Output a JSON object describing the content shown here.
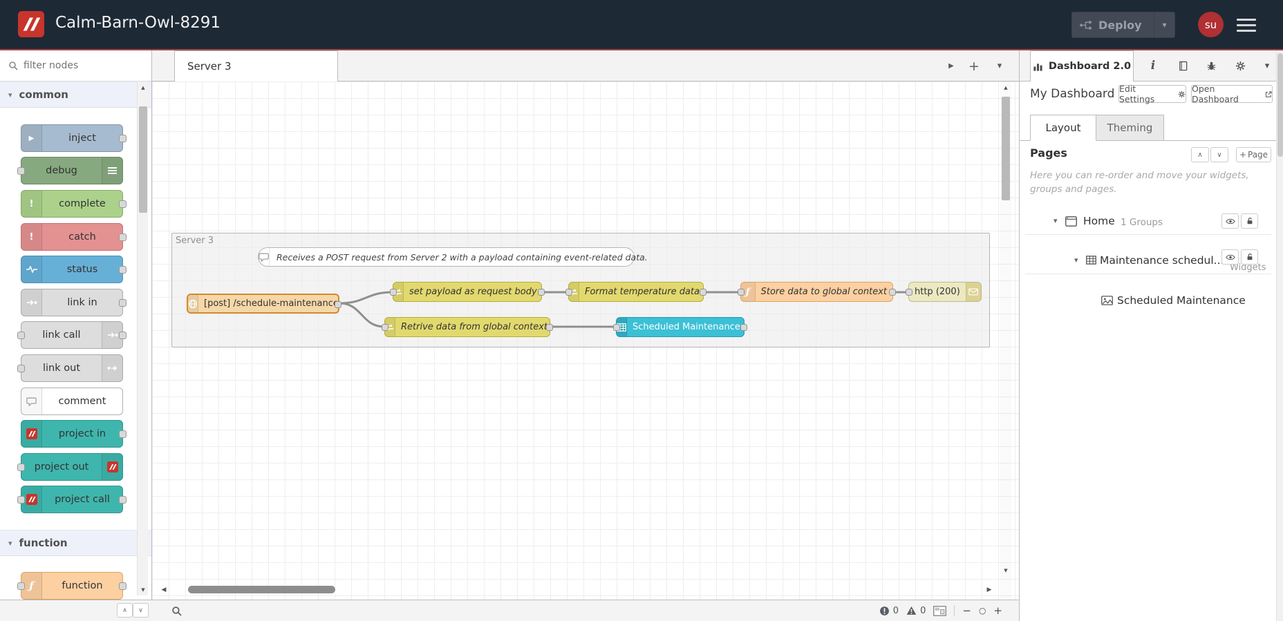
{
  "colors": {
    "header_bg": "#1e2936",
    "header_underline": "#aa4444",
    "brand_red": "#c7352c",
    "deploy_bg": "#434a56",
    "node_inject": "#a6bbcf",
    "node_debug": "#87a980",
    "node_complete": "#abd18b",
    "node_catch": "#e49191",
    "node_status": "#66b0d8",
    "node_link": "#dddddd",
    "node_project": "#3eb6ad",
    "node_function": "#fdd0a2",
    "node_change": "#e2d96e",
    "node_http_in": "#f6d7a8",
    "node_http_response": "#ece9c2",
    "node_ui_table": "#3bc0d6",
    "wire": "#8f8f8f"
  },
  "header": {
    "title": "Calm-Barn-Owl-8291",
    "deploy_label": "Deploy",
    "user_initials": "su"
  },
  "palette": {
    "filter_placeholder": "filter nodes",
    "categories": [
      {
        "label": "common",
        "nodes": [
          {
            "label": "inject",
            "icon": "▶"
          },
          {
            "label": "debug"
          },
          {
            "label": "complete",
            "icon": "!"
          },
          {
            "label": "catch",
            "icon": "!"
          },
          {
            "label": "status"
          },
          {
            "label": "link in"
          },
          {
            "label": "link call"
          },
          {
            "label": "link out"
          },
          {
            "label": "comment"
          },
          {
            "label": "project in"
          },
          {
            "label": "project out"
          },
          {
            "label": "project call"
          }
        ]
      },
      {
        "label": "function",
        "nodes": [
          {
            "label": "function",
            "icon": "ƒ"
          }
        ]
      }
    ]
  },
  "workspace": {
    "tab_label": "Server 3",
    "group_label": "Server 3",
    "comment_text": "Receives a POST request from Server 2 with a payload containing event-related data.",
    "nodes": {
      "http_in": "[post] /schedule-maintenance",
      "set_payload": "set payload as request body",
      "format_temp": "Format temperature data.",
      "store_global": "Store data to global context",
      "http_response": "http (200)",
      "retrieve_global": "Retrive data from global context",
      "table_widget": "Scheduled Maintenance"
    },
    "function_glyph": "ƒ"
  },
  "sidebar": {
    "active_tab_label": "Dashboard 2.0",
    "info_tab_label": "i",
    "dashboard_name": "My Dashboard",
    "edit_settings_label": "Edit Settings",
    "open_dashboard_label": "Open Dashboard",
    "layout_tab": "Layout",
    "theming_tab": "Theming",
    "pages_heading": "Pages",
    "add_page_label": "Page",
    "help_text": "Here you can re-order and move your widgets, groups and pages.",
    "tree": {
      "page_label": "Home",
      "page_meta": "1 Groups",
      "group_label": "Maintenance schedul...",
      "group_meta": "Widgets",
      "widget_label": "Scheduled Maintenance"
    }
  },
  "footer": {
    "error_count": "0",
    "warning_count": "0"
  },
  "icons": {
    "chevron_down": "▾",
    "chevron_right": "▸",
    "play": "▶",
    "add": "+",
    "collapse_all": "∧",
    "expand_all": "∨",
    "zoom_out": "−",
    "zoom_reset": "○",
    "zoom_in": "+",
    "scroll_up": "▲",
    "scroll_down": "▼",
    "scroll_left": "◀",
    "scroll_right": "▶"
  }
}
